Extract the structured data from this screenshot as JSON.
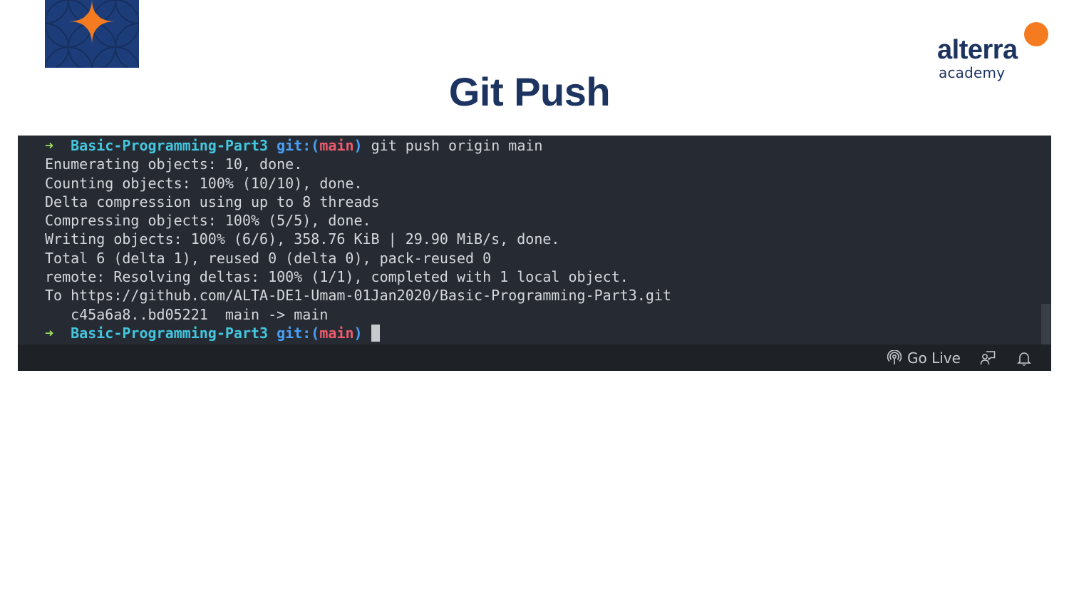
{
  "slide": {
    "title": "Git Push",
    "brand": {
      "name": "alterra",
      "subtitle": "academy",
      "accent_color": "#f47b20",
      "navy_color": "#1d3461"
    },
    "pattern_logo": {
      "icon": "four-point-star-pattern-icon",
      "background": "#1d3d7a",
      "star_color": "#f47b20"
    }
  },
  "terminal": {
    "prompt": {
      "arrow": "➜",
      "directory": "Basic-Programming-Part3",
      "git_prefix": "git:(",
      "branch": "main",
      "git_suffix": ")"
    },
    "command": "git push origin main",
    "output_lines": [
      "Enumerating objects: 10, done.",
      "Counting objects: 100% (10/10), done.",
      "Delta compression using up to 8 threads",
      "Compressing objects: 100% (5/5), done.",
      "Writing objects: 100% (6/6), 358.76 KiB | 29.90 MiB/s, done.",
      "Total 6 (delta 1), reused 0 (delta 0), pack-reused 0",
      "remote: Resolving deltas: 100% (1/1), completed with 1 local object.",
      "To https://github.com/ALTA-DE1-Umam-01Jan2020/Basic-Programming-Part3.git",
      "   c45a6a8..bd05221  main -> main"
    ],
    "colors": {
      "background": "#262b33",
      "arrow": "#9ce15f",
      "directory": "#43c6de",
      "git": "#4a9ff5",
      "branch": "#ef5a6d",
      "text": "#d4d7dc"
    }
  },
  "status_bar": {
    "go_live_label": "Go Live",
    "go_live_icon": "broadcast-icon",
    "feedback_icon": "feedback-person-icon",
    "notification_icon": "bell-icon"
  }
}
